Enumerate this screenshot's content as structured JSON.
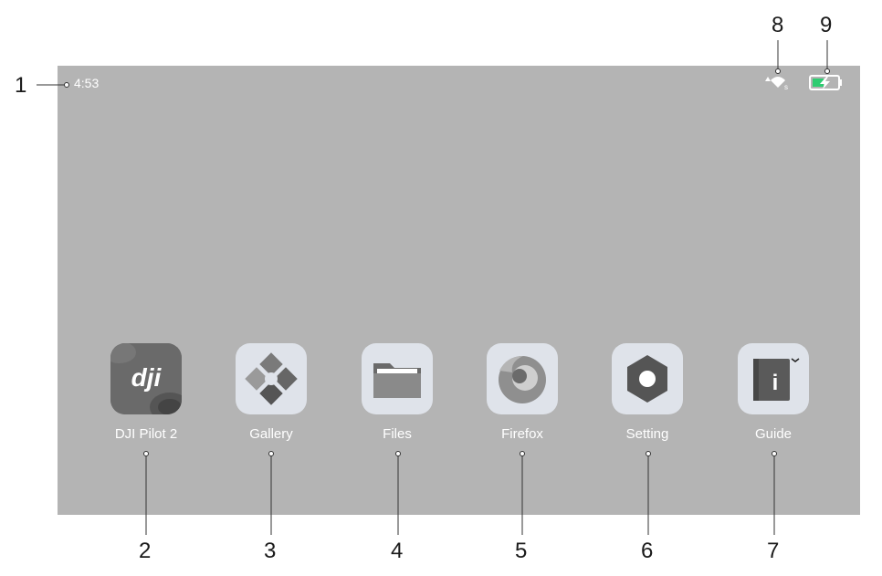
{
  "status_bar": {
    "time": "4:53",
    "signal_icon": "wifi-signal-icon",
    "battery_icon": "battery-charging-icon"
  },
  "apps": [
    {
      "label": "DJI Pilot 2",
      "icon": "dji-pilot-icon",
      "callout": "2"
    },
    {
      "label": "Gallery",
      "icon": "gallery-icon",
      "callout": "3"
    },
    {
      "label": "Files",
      "icon": "files-icon",
      "callout": "4"
    },
    {
      "label": "Firefox",
      "icon": "firefox-icon",
      "callout": "5"
    },
    {
      "label": "Setting",
      "icon": "setting-icon",
      "callout": "6"
    },
    {
      "label": "Guide",
      "icon": "guide-icon",
      "callout": "7"
    }
  ],
  "callouts": {
    "time": "1",
    "signal": "8",
    "battery": "9"
  },
  "dji_logo_text": "dji",
  "guide_letter": "i",
  "colors": {
    "screen": "#b4b4b4",
    "battery_fill": "#2ecc71",
    "label": "#ffffff"
  }
}
